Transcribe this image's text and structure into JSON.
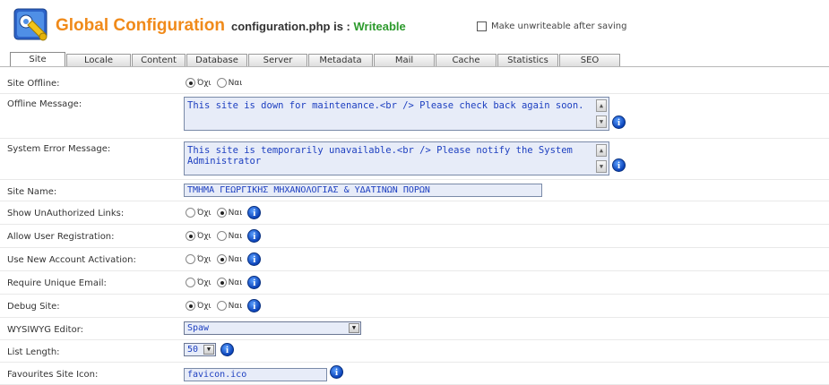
{
  "header": {
    "title": "Global Configuration",
    "config_file": "configuration.php is : ",
    "config_state": "Writeable",
    "unwriteable_label": "Make unwriteable after saving"
  },
  "tabs": [
    "Site",
    "Locale",
    "Content",
    "Database",
    "Server",
    "Metadata",
    "Mail",
    "Cache",
    "Statistics",
    "SEO"
  ],
  "radio_labels": {
    "no": "Όχι",
    "yes": "Ναι"
  },
  "fields": {
    "site_offline": {
      "label": "Site Offline:",
      "value": "no"
    },
    "offline_message": {
      "label": "Offline Message:",
      "value": "This site is down for maintenance.<br /> Please check back again soon."
    },
    "system_error_message": {
      "label": "System Error Message:",
      "value": "This site is temporarily unavailable.<br /> Please notify the System Administrator"
    },
    "site_name": {
      "label": "Site Name:",
      "value": "ΤΜΗΜΑ ΓΕΩΡΓΙΚΗΣ ΜΗΧΑΝΟΛΟΓΙΑΣ & ΥΔΑΤΙΝΩΝ ΠΟΡΩΝ"
    },
    "show_unauthorized_links": {
      "label": "Show UnAuthorized Links:",
      "value": "yes"
    },
    "allow_user_registration": {
      "label": "Allow User Registration:",
      "value": "no"
    },
    "use_new_account_activation": {
      "label": "Use New Account Activation:",
      "value": "yes"
    },
    "require_unique_email": {
      "label": "Require Unique Email:",
      "value": "yes"
    },
    "debug_site": {
      "label": "Debug Site:",
      "value": "no"
    },
    "wysiwyg_editor": {
      "label": "WYSIWYG Editor:",
      "value": "Spaw"
    },
    "list_length": {
      "label": "List Length:",
      "value": "50"
    },
    "favourites_site_icon": {
      "label": "Favourites Site Icon:",
      "value": "favicon.ico"
    }
  },
  "icons": {
    "info": "info-icon",
    "logo": "global-config-logo"
  },
  "colors": {
    "title": "#f08a1a",
    "writeable": "#2c9a2c",
    "field_text": "#1d3fc0",
    "field_bg": "#e7ecf8"
  }
}
